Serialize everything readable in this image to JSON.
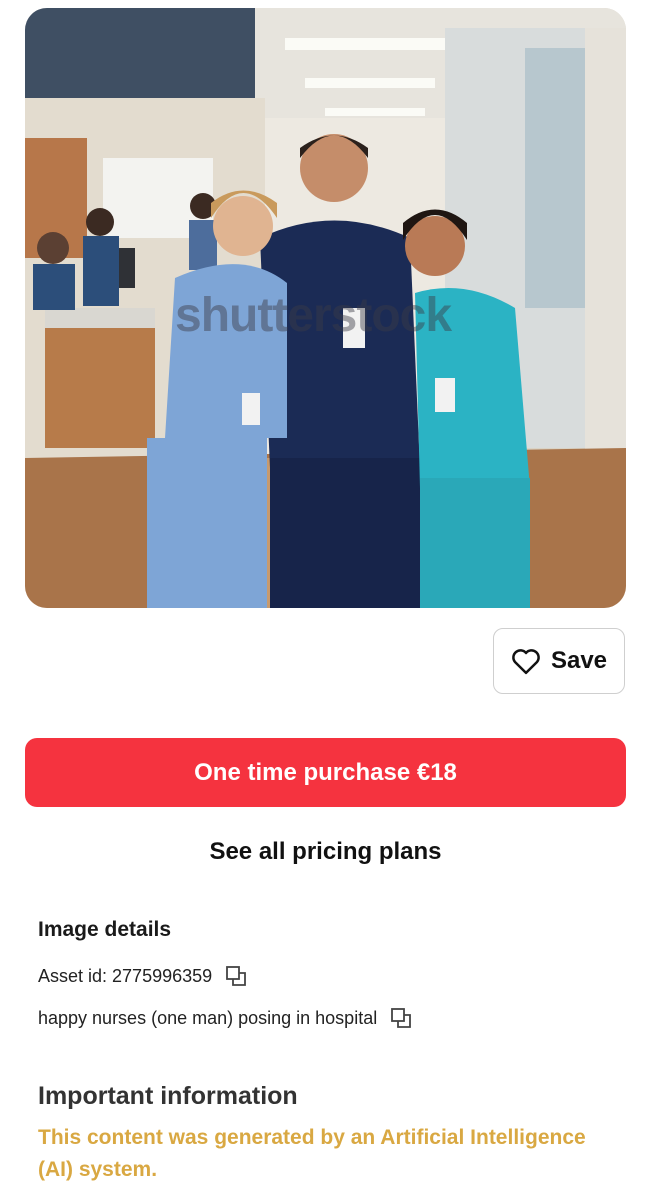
{
  "image": {
    "alt": "happy nurses (one man) posing in hospital",
    "watermark": "shutterstock"
  },
  "actions": {
    "save_label": "Save",
    "purchase_label": "One time purchase €18",
    "pricing_link": "See all pricing plans"
  },
  "details": {
    "title": "Image details",
    "asset_id": "Asset id: 2775996359",
    "description": "happy nurses (one man) posing in hospital"
  },
  "important": {
    "title": "Important information",
    "notice": "This content was generated by an Artificial Intelligence (AI) system."
  },
  "icons": {
    "save": "heart-icon",
    "copy": "copy-icon"
  },
  "colors": {
    "purchase_button": "#f5333f",
    "ai_notice": "#d9a842",
    "save_border": "#cfcfcf"
  }
}
